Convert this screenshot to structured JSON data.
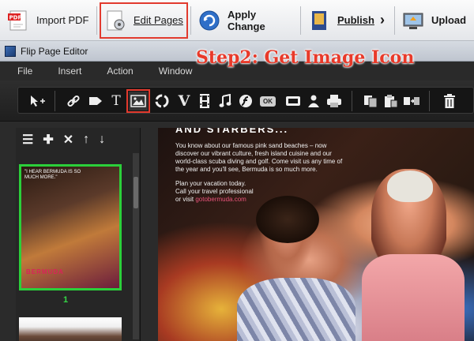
{
  "ribbon": {
    "import_label": "Import PDF",
    "edit_label": "Edit Pages",
    "apply_label": "Apply Change",
    "publish_label": "Publish",
    "upload_label": "Upload"
  },
  "window": {
    "title": "Flip Page Editor",
    "annotation": "Step2: Get Image Icon"
  },
  "menu": [
    "File",
    "Insert",
    "Action",
    "Window"
  ],
  "toolbar": {
    "text_tool_glyph": "T",
    "ok_label": "OK",
    "video_glyph": "V"
  },
  "thumbnails": {
    "page_number": "1",
    "thumb_caption": "\"I HEAR BERMUDA IS SO MUCH MORE.\" ",
    "thumb_brand": "BERMUDA"
  },
  "canvas": {
    "header": "AND STARBERS...",
    "copy1": "You know about our famous pink sand beaches – now discover our vibrant culture, fresh island cuisine and our world-class scuba diving and golf. Come visit us any time of the year and you'll see, Bermuda is so much more.",
    "copy2a": "Plan your vacation today.",
    "copy2b": "Call your travel professional",
    "copy2c": "or visit ",
    "copy2_url": "gotobermuda.com"
  },
  "colors": {
    "annotation_red": "#e83a2a",
    "selected_page_green": "#2bcf3a"
  }
}
